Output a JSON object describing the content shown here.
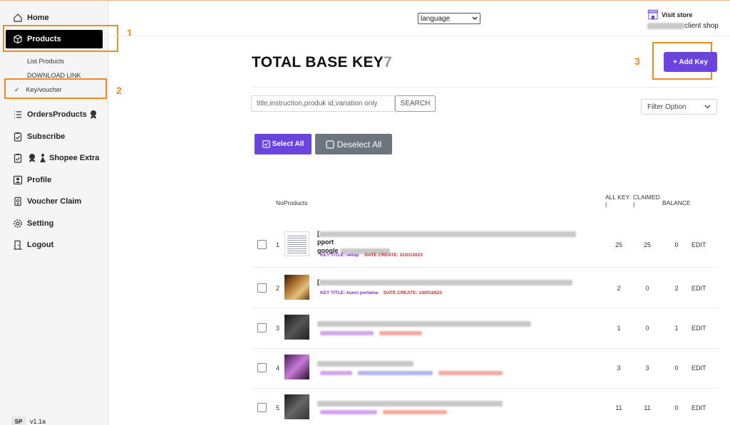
{
  "sidebar": {
    "nav": {
      "home": "Home",
      "products": "Products",
      "orders": "OrdersProducts",
      "subscribe": "Subscribe",
      "shopee_extra": "Shopee Extra",
      "profile": "Profile",
      "voucher_claim": "Voucher Claim",
      "setting": "Setting",
      "logout": "Logout"
    },
    "sub": {
      "list_products": "List Products",
      "download_link": "DOWNLOAD LINK",
      "key_voucher": "Key/voucher",
      "check": "✓"
    },
    "badge": "SP",
    "version": "v1.1a"
  },
  "annotations": [
    "1",
    "2",
    "3"
  ],
  "header": {
    "language": "language",
    "visit_store": "Visit store",
    "shop_suffix": "client shop"
  },
  "main": {
    "title": "TOTAL BASE KEY",
    "count": "7",
    "add_key": "+ Add Key",
    "search_placeholder": "title,instruction,produk id,variation only",
    "search_btn": "SEARCH",
    "filter": "Filter Option",
    "select_all": "Select All",
    "deselect_all": "Deselect All"
  },
  "table": {
    "headers": {
      "no_products": "NoProducts",
      "all_key": "ALL KEY",
      "claimed": "CLAIMED",
      "balance": "BALANCE",
      "sep": "|"
    },
    "rows": [
      {
        "no": "1",
        "name_tail": "pport",
        "name_line2": "google",
        "key_title": "KEY TITLE: setup",
        "date": "DATE CREATE: 11/01/2023",
        "all": "25",
        "claimed": "25",
        "balance": "0",
        "edit": "EDIT"
      },
      {
        "no": "2",
        "name_tail": "",
        "name_line2": "",
        "key_title": "KEY TITLE: kunci pertama",
        "date": "DATE CREATE: 14/01/2023",
        "all": "2",
        "claimed": "0",
        "balance": "2",
        "edit": "EDIT"
      },
      {
        "no": "3",
        "name_tail": "",
        "name_line2": "",
        "key_title": "",
        "date": "",
        "all": "1",
        "claimed": "0",
        "balance": "1",
        "edit": "EDIT"
      },
      {
        "no": "4",
        "name_tail": "",
        "name_line2": "",
        "key_title": "",
        "date": "",
        "all": "3",
        "claimed": "3",
        "balance": "0",
        "edit": "EDIT"
      },
      {
        "no": "5",
        "name_tail": "",
        "name_line2": "",
        "key_title": "",
        "date": "",
        "all": "11",
        "claimed": "11",
        "balance": "0",
        "edit": "EDIT"
      }
    ]
  },
  "colors": {
    "accent": "#6a44dc",
    "annotation": "#f08a24",
    "key_title": "#8a2be2",
    "date": "#e0252b"
  }
}
